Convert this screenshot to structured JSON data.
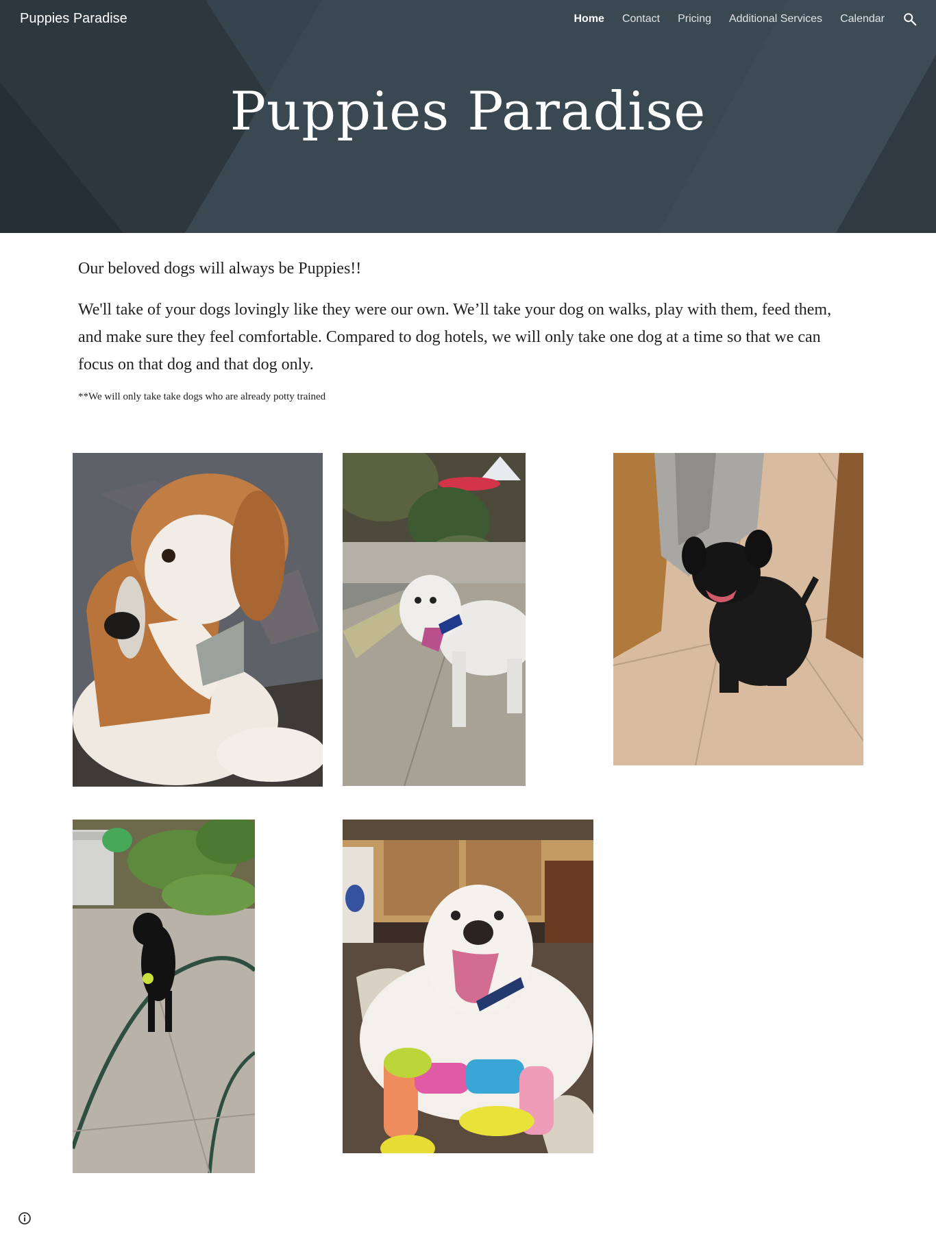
{
  "site": {
    "name": "Puppies Paradise",
    "hero_title": "Puppies Paradise"
  },
  "nav": {
    "items": [
      "Home",
      "Contact",
      "Pricing",
      "Additional Services",
      "Calendar"
    ],
    "active": "Home",
    "search_icon": "search-icon"
  },
  "intro": {
    "lead": "Our beloved dogs will always be Puppies!!",
    "body": "We'll take of your dogs lovingly like they were our own. We’ll take your dog on walks, play with them, feed them, and make sure they feel comfortable. Compared to dog hotels, we will only take one dog at a time so that we can focus on that dog and that dog only.",
    "note": "**We will only take take dogs who are already potty trained"
  },
  "photos": [
    {
      "subject": "beagle-on-rug"
    },
    {
      "subject": "white-poodle-on-sidewalk"
    },
    {
      "subject": "black-labrador-on-tile"
    },
    {
      "subject": "black-dog-with-ball-on-driveway"
    },
    {
      "subject": "white-doodle-with-toy"
    }
  ],
  "colors": {
    "hero_bg": "#34414a",
    "text": "#212121"
  },
  "footer": {
    "info_icon": "info-icon"
  }
}
